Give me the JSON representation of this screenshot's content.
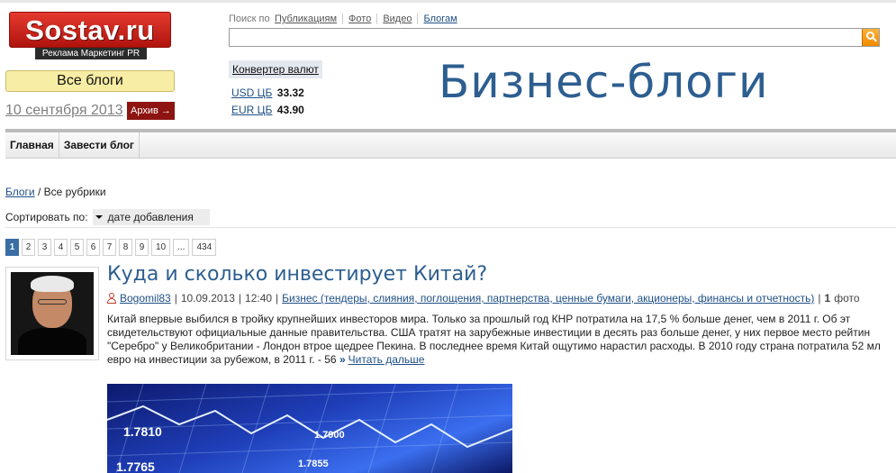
{
  "logo": {
    "text": "Sostav.ru",
    "tagline": "Реклама Маркетинг PR"
  },
  "search": {
    "label": "Поиск по",
    "scopes": [
      "Публикациям",
      "Фото",
      "Видео",
      "Блогам"
    ],
    "active_scope": "Блогам",
    "placeholder": ""
  },
  "sidebar": {
    "all_blogs": "Все блоги",
    "date": "10 сентября 2013",
    "archive": "Архив →"
  },
  "currency": {
    "converter": "Конвертер валют",
    "usd_label": "USD ЦБ",
    "usd_value": "33.32",
    "eur_label": "EUR ЦБ",
    "eur_value": "43.90"
  },
  "page_title": "Бизнес-блоги",
  "nav": [
    "Главная",
    "Завести блог"
  ],
  "breadcrumb": {
    "link": "Блоги",
    "current": " / Все рубрики"
  },
  "sort": {
    "label": "Сортировать по:",
    "value": "дате добавления"
  },
  "pager": [
    "1",
    "2",
    "3",
    "4",
    "5",
    "6",
    "7",
    "8",
    "9",
    "10",
    "...",
    "434"
  ],
  "article": {
    "title": "Куда и сколько инвестирует Китай?",
    "author": "Bogomil83",
    "date": "10.09.2013",
    "time": "12:40",
    "category": "Бизнес (тендеры, слияния, поглощения, партнерства, ценные бумаги, акционеры, финансы и отчетность)",
    "photos_count": "1",
    "photos_label": "фото",
    "excerpt_lines": [
      "Китай впервые выбился в тройку крупнейших инвесторов мира. Только за прошлый год КНР потратила на 17,5 % больше денег, чем в 2011 г. Об эт",
      "свидетельствуют официальные данные правительства. США тратят на зарубежные инвестиции в десять раз больше денег, у них первое место рейтин",
      "\"Серебро\" у Великобритании - Лондон втрое щедрее Пекина. В последнее время Китай ощутимо нарастил расходы. В 2010 году страна потратила 52 мл",
      "евро на инвестиции за рубежом, в 2011 г. - 56"
    ],
    "read_more": "Читать дальше",
    "image_numbers": [
      "1.7810",
      "1.7900",
      "1.7765",
      "1.7855"
    ]
  }
}
